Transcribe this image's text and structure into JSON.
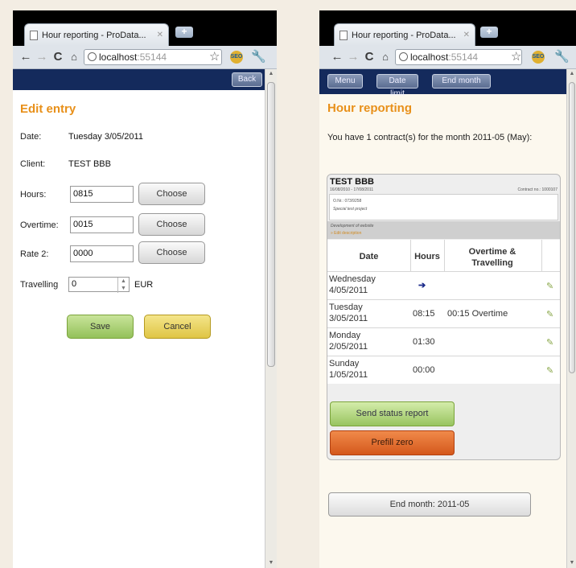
{
  "left": {
    "tab_title": "Hour reporting - ProData...",
    "address": "localhost",
    "port": ":55144",
    "back_label": "Back",
    "heading": "Edit entry",
    "date_label": "Date:",
    "date_value": "Tuesday 3/05/2011",
    "client_label": "Client:",
    "client_value": "TEST BBB",
    "hours_label": "Hours:",
    "hours_value": "0815",
    "overtime_label": "Overtime:",
    "overtime_value": "0015",
    "rate2_label": "Rate 2:",
    "rate2_value": "0000",
    "choose_label": "Choose",
    "travelling_label": "Travelling",
    "travelling_value": "0",
    "currency": "EUR",
    "save_label": "Save",
    "cancel_label": "Cancel"
  },
  "right": {
    "tab_title": "Hour reporting - ProData...",
    "address": "localhost",
    "port": ":55144",
    "menu_label": "Menu",
    "date_limit_label": "Date limit",
    "end_month_top_label": "End month",
    "heading": "Hour reporting",
    "contracts_text": "You have 1 contract(s) for the month 2011-05 (May):",
    "client_name": "TEST BBB",
    "contract_dates": "16/08/2010 - 17/08/2011",
    "contract_no": "Contract no.: 1000107",
    "order_no": "O.Nr.: 073/9258",
    "project": "Special test project",
    "task": "Development of website",
    "task_link": "» Edit description",
    "headers": [
      "Date",
      "Hours",
      "Overtime & Travelling"
    ],
    "rows": [
      {
        "day": "Wednesday",
        "date": "4/05/2011",
        "hours": "",
        "extra": ""
      },
      {
        "day": "Tuesday",
        "date": "3/05/2011",
        "hours": "08:15",
        "extra": "00:15 Overtime"
      },
      {
        "day": "Monday",
        "date": "2/05/2011",
        "hours": "01:30",
        "extra": ""
      },
      {
        "day": "Sunday",
        "date": "1/05/2011",
        "hours": "00:00",
        "extra": ""
      }
    ],
    "send_status_label": "Send status report",
    "prefill_label": "Prefill zero",
    "end_month_label": "End month: 2011-05"
  },
  "icons": {
    "back": "arrow-left",
    "forward": "arrow-right",
    "reload": "reload",
    "home": "home",
    "bookmark": "star",
    "extension": "seo-badge",
    "menu": "wrench",
    "row_action": "pencil",
    "current_day": "right-arrow"
  },
  "colors": {
    "heading_orange": "#e8901a",
    "app_bar_navy": "#142a5c",
    "save_green": "#93c15a",
    "cancel_yellow": "#dfc545",
    "prefill_orange": "#d4581c"
  }
}
